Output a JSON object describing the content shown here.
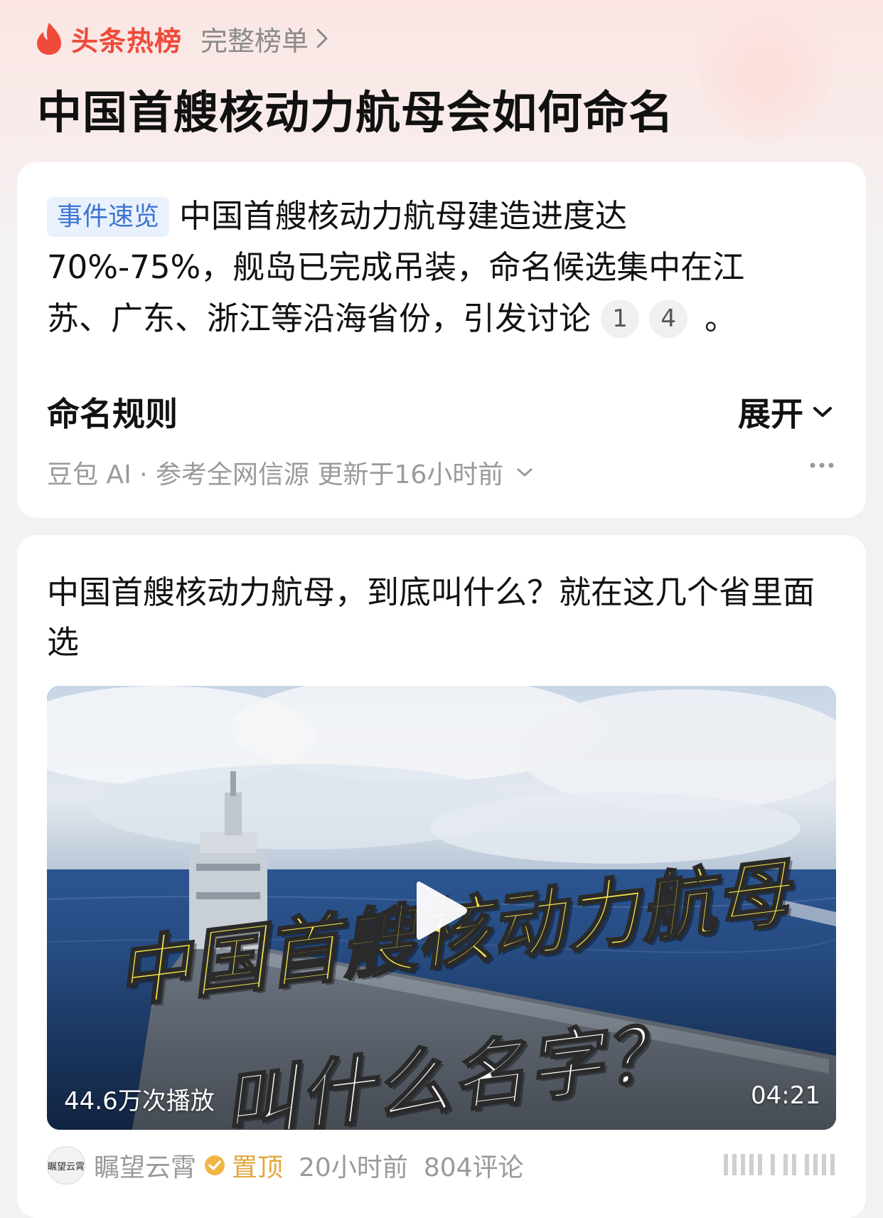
{
  "header": {
    "brand": "头条热榜",
    "full_list_label": "完整榜单",
    "page_title": "中国首艘核动力航母会如何命名"
  },
  "event_card": {
    "tag": "事件速览",
    "summary_line1": "中国首艘核动力航母建造进度达",
    "summary_line2": "70%-75%，舰岛已完成吊装，命名候选集中在江",
    "summary_line3": "苏、广东、浙江等沿海省份，引发讨论",
    "ref1": "1",
    "ref2": "4",
    "summary_end": "。",
    "rule_title": "命名规则",
    "expand_label": "展开",
    "source_text": "豆包 AI · 参考全网信源 更新于16小时前"
  },
  "article": {
    "title": "中国首艘核动力航母，到底叫什么？就在这几个省里面选",
    "video_overlay_line1": "中国首艘核动力航母",
    "video_overlay_line2": "叫什么名字？",
    "plays": "44.6万次播放",
    "duration": "04:21",
    "author": "瞩望云霄",
    "avatar_text": "瞩望云霄",
    "pinned": "置顶",
    "time_ago": "20小时前",
    "comments": "804评论"
  },
  "colors": {
    "brand_red": "#f04a3a",
    "tag_blue": "#3c75d3",
    "pinned_gold": "#e2a63a"
  },
  "icons": {
    "brand": "flame-icon",
    "full_list": "chevron-right-icon",
    "expand": "chevron-down-icon",
    "source": "chevron-down-icon",
    "more": "more-horizontal-icon",
    "video": "play-icon",
    "verified": "verified-badge-icon"
  }
}
